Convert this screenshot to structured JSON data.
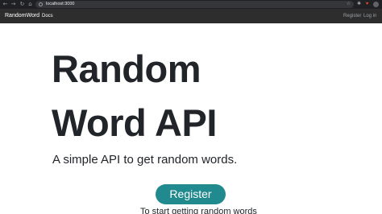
{
  "browser": {
    "url": "localhost:3000",
    "back_icon": "back-arrow-icon",
    "forward_icon": "forward-arrow-icon",
    "reload_icon": "reload-icon",
    "home_icon": "home-icon"
  },
  "navbar": {
    "brand": "RandomWord",
    "docs": "Docs",
    "register": "Register",
    "login": "Log in"
  },
  "hero": {
    "title_line1": "Random",
    "title_line2": "Word API",
    "subtitle": "A simple API to get random words.",
    "register_button": "Register",
    "cta_text": "To start getting random words"
  },
  "colors": {
    "navbar_bg": "#2d2d2d",
    "button_bg": "#218a8f",
    "text": "#212529"
  }
}
